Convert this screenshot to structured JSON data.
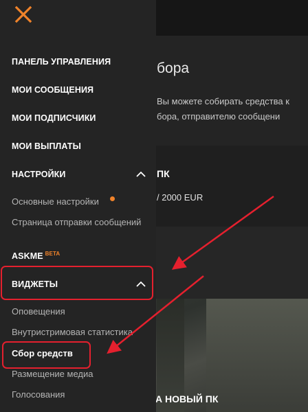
{
  "background": {
    "title": "бора",
    "desc_line1": "Вы можете собирать средства к",
    "desc_line2": "бора, отправителю сообщени",
    "goal_title": "ПК",
    "goal_amount": "/ 2000 EUR",
    "banner_text": "А НОВЫЙ ПК"
  },
  "sidebar": {
    "close_icon": "close-icon",
    "items": [
      {
        "label": "ПАНЕЛЬ УПРАВЛЕНИЯ"
      },
      {
        "label": "МОИ СООБЩЕНИЯ"
      },
      {
        "label": "МОИ ПОДПИСЧИКИ"
      },
      {
        "label": "МОИ ВЫПЛАТЫ"
      },
      {
        "label": "НАСТРОЙКИ"
      },
      {
        "label": "ASKME",
        "badge": "BETA"
      },
      {
        "label": "ВИДЖЕТЫ"
      }
    ],
    "settings_sub": [
      {
        "label": "Основные настройки"
      },
      {
        "label": "Страница отправки сообщений"
      }
    ],
    "widgets_sub": [
      {
        "label": "Оповещения"
      },
      {
        "label": "Внутристримовая статистика"
      },
      {
        "label": "Сбор средств"
      },
      {
        "label": "Размещение медиа"
      },
      {
        "label": "Голосования"
      }
    ]
  },
  "colors": {
    "accent": "#f0832a",
    "highlight": "#e5202e",
    "sidebar_bg": "#242424"
  }
}
